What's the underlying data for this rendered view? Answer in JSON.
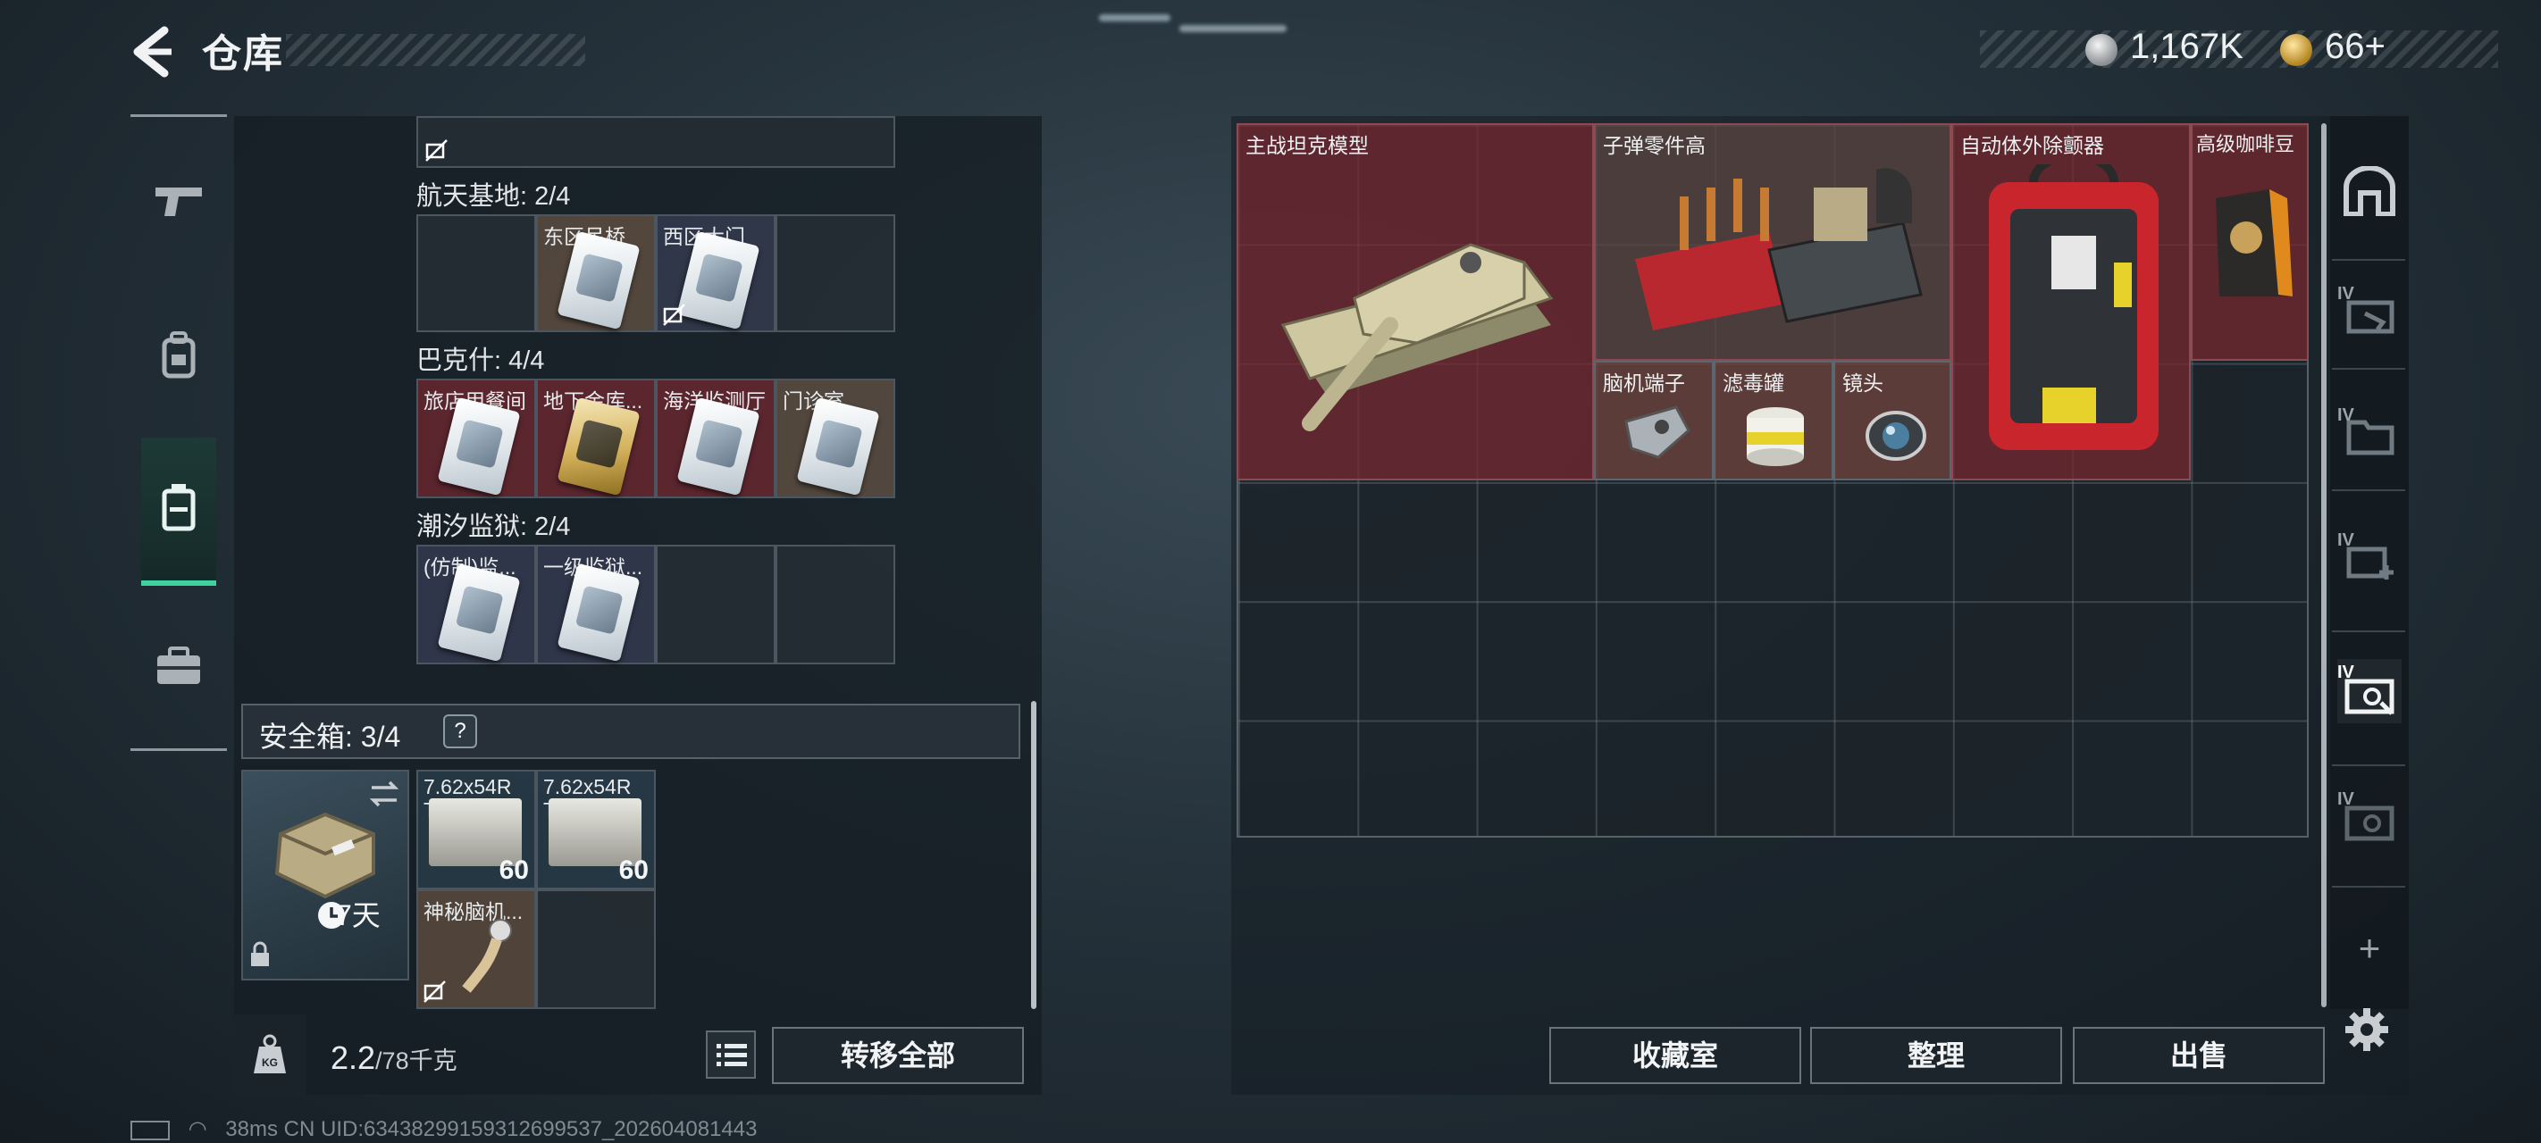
{
  "header": {
    "title": "仓库",
    "currency": [
      {
        "icon": "silver-coin-icon",
        "value": "1,167K"
      },
      {
        "icon": "gold-coin-icon",
        "value": "66+"
      }
    ]
  },
  "left_nav": [
    {
      "icon": "gun-icon",
      "active": false
    },
    {
      "icon": "backpack-icon",
      "active": false
    },
    {
      "icon": "storage-case-icon",
      "active": true
    },
    {
      "icon": "toolbox-icon",
      "active": false
    }
  ],
  "key_groups": [
    {
      "label": "航天基地: 2/4",
      "slots": [
        "东区吊桥",
        "西区大门",
        "",
        ""
      ]
    },
    {
      "label": "巴克什: 4/4",
      "slots": [
        "旅店用餐间",
        "地下金库...",
        "海洋监测厅",
        "门诊室"
      ]
    },
    {
      "label": "潮汐监狱: 2/4",
      "slots": [
        "(仿制)监...",
        "一级监狱...",
        "",
        ""
      ]
    }
  ],
  "safe_box": {
    "label": "安全箱: 3/4",
    "help": "?",
    "time": "7天",
    "items": [
      {
        "name": "7.62x54R T46M",
        "count": "60"
      },
      {
        "name": "7.62x54R T46M",
        "count": "60"
      },
      {
        "name": "神秘脑机...",
        "count": ""
      }
    ]
  },
  "footer_left": {
    "weight": "2.2",
    "weight_cap": "/78千克",
    "kg_icon": "weight-icon",
    "list_icon": "list-icon",
    "transfer": "转移全部"
  },
  "status_bar": "38ms     CN UID:6343829915931269​9537_202604081443",
  "storage": {
    "items": [
      {
        "name": "主战坦克模型"
      },
      {
        "name": "子弹零件高"
      },
      {
        "name": "自动体外除颤器"
      },
      {
        "name": "高级咖啡豆"
      },
      {
        "name": "脑机端子"
      },
      {
        "name": "滤毒罐"
      },
      {
        "name": "镜头"
      }
    ],
    "buttons": [
      "收藏室",
      "整理",
      "出售"
    ]
  },
  "right_tabs": [
    {
      "icon": "garage-icon",
      "level": ""
    },
    {
      "icon": "gun-bench-icon",
      "level": "IV"
    },
    {
      "icon": "folder-icon",
      "level": "IV"
    },
    {
      "icon": "medical-case-icon",
      "level": "IV"
    },
    {
      "icon": "weapon-case-icon",
      "level": "IV"
    },
    {
      "icon": "weapon-case-icon",
      "level": "IV"
    },
    {
      "icon": "plus-icon",
      "level": "+"
    }
  ],
  "colors": {
    "accent": "#3ed39e",
    "item_bg": "#7a2830"
  }
}
